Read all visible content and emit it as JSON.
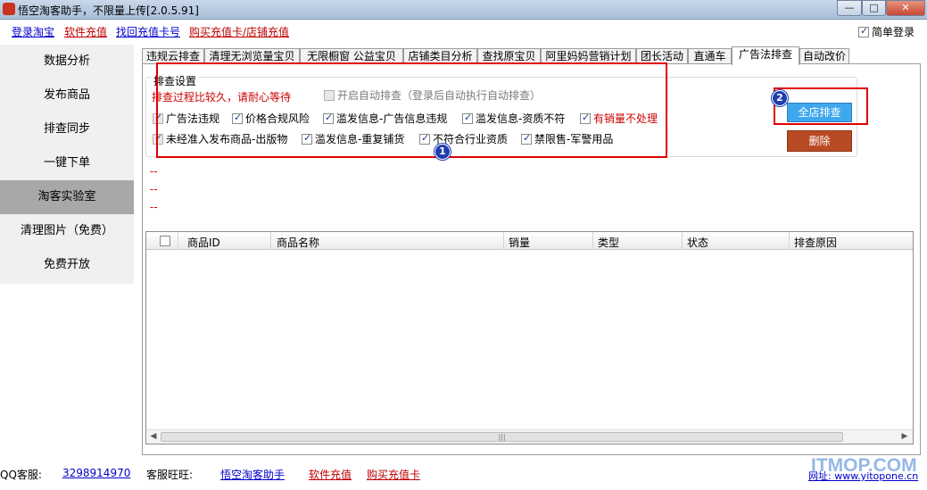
{
  "window": {
    "title": "悟空淘客助手，不限量上传[2.0.5.91]",
    "buttons": {
      "minimize": "—",
      "maximize": "□",
      "close": "✕"
    }
  },
  "topbar": {
    "links": [
      "登录淘宝",
      "软件充值",
      "找回充值卡号",
      "购买充值卡/店铺充值"
    ],
    "simple_login": {
      "label": "简单登录",
      "checked": true
    }
  },
  "sidebar": {
    "items": [
      {
        "label": "数据分析",
        "active": false
      },
      {
        "label": "发布商品",
        "active": false
      },
      {
        "label": "排查同步",
        "active": false
      },
      {
        "label": "一键下单",
        "active": false
      },
      {
        "label": "淘客实验室",
        "active": true
      },
      {
        "label": "清理图片（免费）",
        "active": false
      },
      {
        "label": "免费开放",
        "active": false
      }
    ]
  },
  "tabs": [
    {
      "label": "违规云排查"
    },
    {
      "label": "清理无浏览量宝贝"
    },
    {
      "label": "无限橱窗 公益宝贝"
    },
    {
      "label": "店铺类目分析"
    },
    {
      "label": "查找原宝贝"
    },
    {
      "label": "阿里妈妈营销计划"
    },
    {
      "label": "团长活动"
    },
    {
      "label": "直通车"
    },
    {
      "label": "广告法排查",
      "active": true
    },
    {
      "label": "自动改价"
    }
  ],
  "settings": {
    "group_title": "排查设置",
    "warning": "排查过程比较久，请耐心等待",
    "auto_option": "开启自动排查（登录后自动执行自动排查）",
    "options": [
      {
        "label": "广告法违规",
        "checked": true
      },
      {
        "label": "价格合规风险",
        "checked": true
      },
      {
        "label": "滥发信息-广告信息违规",
        "checked": true
      },
      {
        "label": "滥发信息-资质不符",
        "checked": true
      },
      {
        "label": "有销量不处理",
        "checked": true,
        "color": "#cc0000"
      },
      {
        "label": "未经准入发布商品-出版物",
        "checked": true
      },
      {
        "label": "滥发信息-重复铺货",
        "checked": true
      },
      {
        "label": "不符合行业资质",
        "checked": true
      },
      {
        "label": "禁限售-军警用品",
        "checked": true
      }
    ]
  },
  "actions": {
    "scan_all": "全店排查",
    "delete": "删除"
  },
  "badges": {
    "one": "1",
    "two": "2"
  },
  "log_lines": [
    "--",
    "--",
    "--"
  ],
  "table": {
    "columns": [
      "商品ID",
      "商品名称",
      "销量",
      "类型",
      "状态",
      "排查原因"
    ],
    "rows": []
  },
  "footer": {
    "qq_label": "QQ客服:",
    "qq_number": "3298914970",
    "wangwang_label": "客服旺旺:",
    "wangwang_name": "悟空淘客助手",
    "links": [
      "软件充值",
      "购买充值卡"
    ],
    "website": "网址: www.yitopone.cn"
  },
  "watermark": "ITMOP.COM"
}
